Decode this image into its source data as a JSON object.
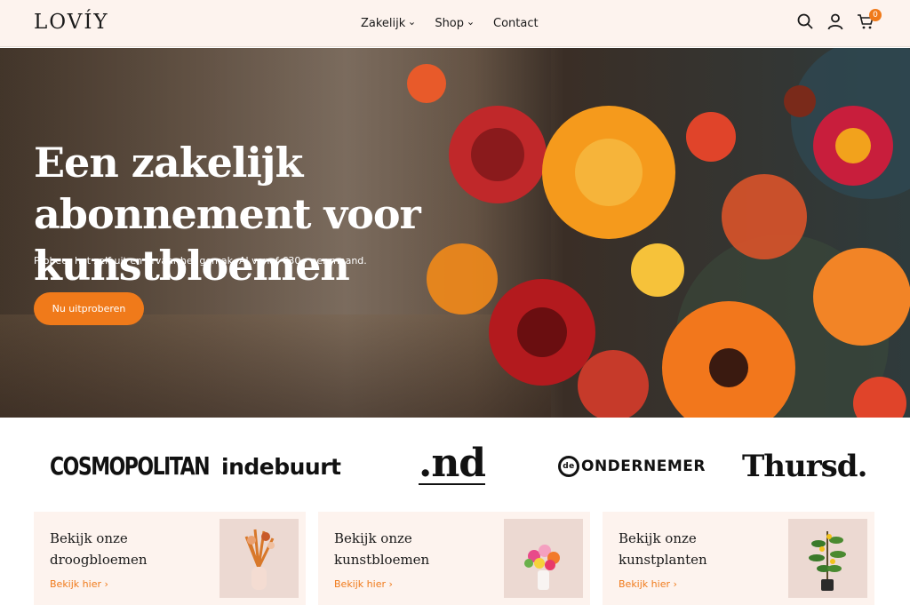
{
  "header": {
    "logo": "LOVÍY",
    "nav": [
      {
        "label": "Zakelijk",
        "has_dropdown": true
      },
      {
        "label": "Shop",
        "has_dropdown": true
      },
      {
        "label": "Contact",
        "has_dropdown": false
      }
    ],
    "icons": [
      "search-icon",
      "account-icon",
      "cart-icon"
    ],
    "cart_count": "0"
  },
  "hero": {
    "title": "Een zakelijk abonnement voor kunstbloemen",
    "subtitle": "Probeer het zelf uit en ervaar het gemak. Al vanaf €30,- per maand.",
    "button_label": "Nu uitproberen"
  },
  "press_logos": [
    "COSMOPOLITAN",
    "indebuurt",
    ".nd",
    "ONDERNEMER",
    "Thursd."
  ],
  "press_logo_parts": {
    "ond_circle": "de"
  },
  "cards": [
    {
      "title": "Bekijk onze droogbloemen",
      "link": "Bekijk hier",
      "image": "dried-flowers-vase"
    },
    {
      "title": "Bekijk onze kunstbloemen",
      "link": "Bekijk hier",
      "image": "artificial-flowers-vase"
    },
    {
      "title": "Bekijk onze kunstplanten",
      "link": "Bekijk hier",
      "image": "artificial-plant-pot"
    }
  ],
  "colors": {
    "accent": "#f07a1a",
    "header_bg": "#fdf3ee",
    "card_bg": "#fdf3ee",
    "text": "#1a1a1a"
  }
}
